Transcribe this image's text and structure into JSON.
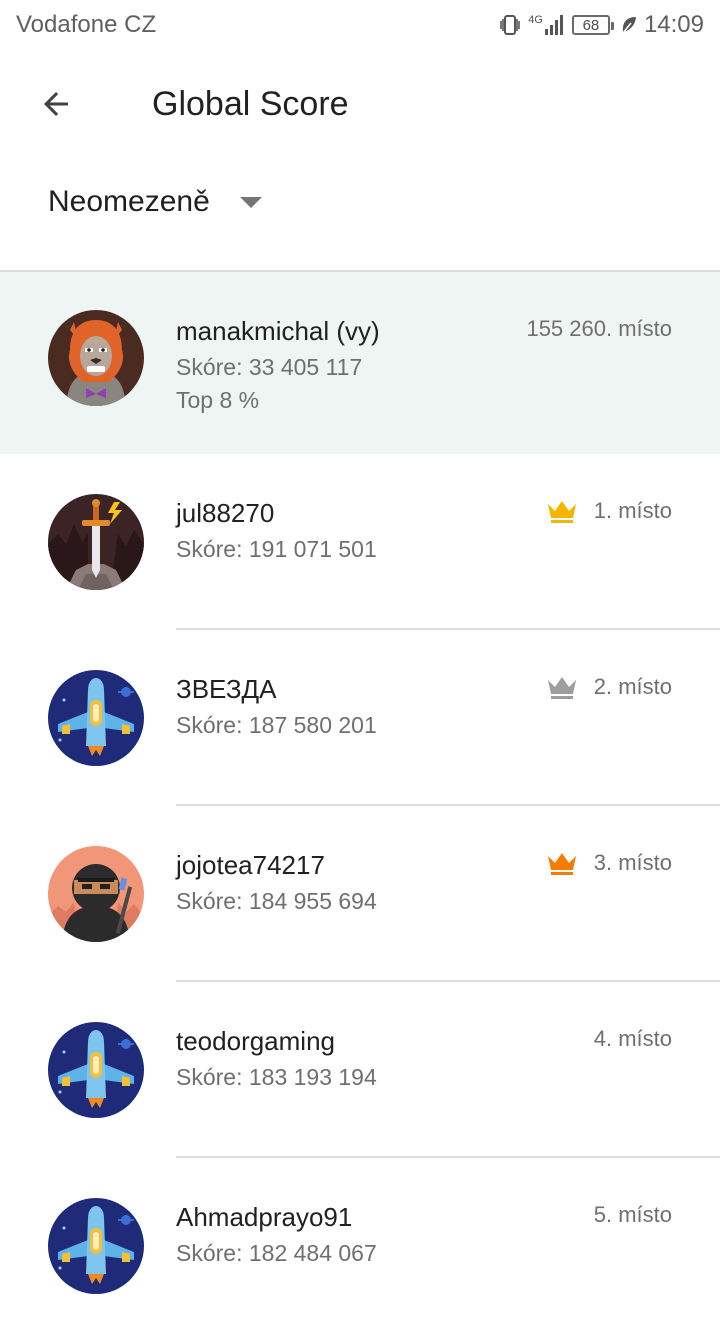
{
  "status_bar": {
    "carrier": "Vodafone CZ",
    "network": "4G",
    "battery": "68",
    "time": "14:09"
  },
  "header": {
    "title": "Global Score"
  },
  "filter": {
    "selected": "Neomezeně"
  },
  "me": {
    "name": "manakmichal (vy)",
    "score": "Skóre: 33 405 117",
    "top": "Top 8 %",
    "rank": "155 260. místo"
  },
  "players": [
    {
      "name": "jul88270",
      "score": "Skóre: 191 071 501",
      "rank": "1. místo",
      "crown_color": "#F5B400"
    },
    {
      "name": "ЗВЕЗДА",
      "score": "Skóre: 187 580 201",
      "rank": "2. místo",
      "crown_color": "#9E9E9E"
    },
    {
      "name": "jojotea74217",
      "score": "Skóre: 184 955 694",
      "rank": "3. místo",
      "crown_color": "#F57C00"
    },
    {
      "name": "teodorgaming",
      "score": "Skóre: 183 193 194",
      "rank": "4. místo"
    },
    {
      "name": "Ahmadprayo91",
      "score": "Skóre: 182 484 067",
      "rank": "5. místo"
    }
  ]
}
